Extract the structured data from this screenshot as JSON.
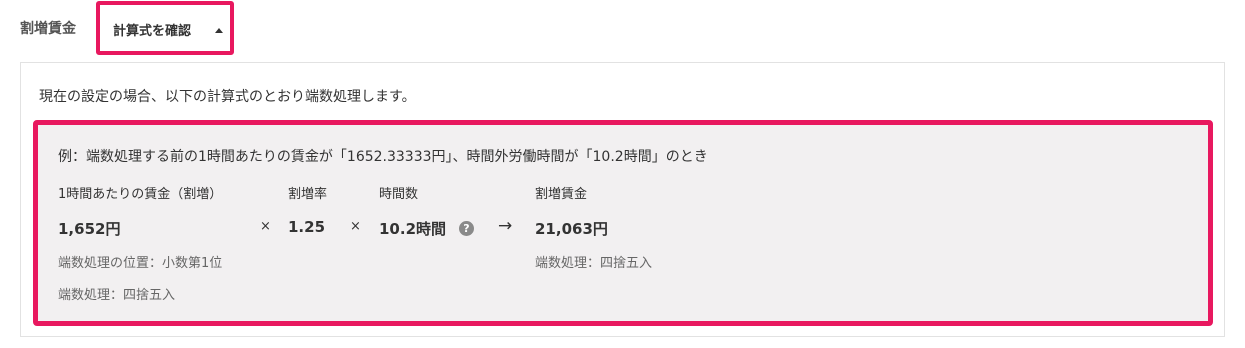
{
  "section": {
    "label": "割増賃金"
  },
  "toggle": {
    "label": "計算式を確認",
    "icon": "caret-up-icon"
  },
  "panel": {
    "description": "現在の設定の場合、以下の計算式のとおり端数処理します。",
    "example": {
      "heading": "例：端数処理する前の1時間あたりの賃金が「1652.33333円」、時間外労働時間が「10.2時間」のとき",
      "columns": {
        "hourly_wage": {
          "header": "1時間あたりの賃金（割増）",
          "value": "1,652円",
          "notes": [
            "端数処理の位置：小数第1位",
            "端数処理：四捨五入"
          ]
        },
        "rate": {
          "header": "割増率",
          "value": "1.25"
        },
        "hours": {
          "header": "時間数",
          "value": "10.2時間",
          "help_icon": "?"
        },
        "result": {
          "header": "割増賃金",
          "value": "21,063円",
          "notes": [
            "端数処理：四捨五入"
          ]
        }
      },
      "operators": {
        "multiply_1": "×",
        "multiply_2": "×",
        "arrow": "→"
      }
    }
  },
  "colors": {
    "highlight_border": "#e8185f",
    "example_background": "#f2f0f1",
    "panel_border": "#e2e2e2"
  }
}
